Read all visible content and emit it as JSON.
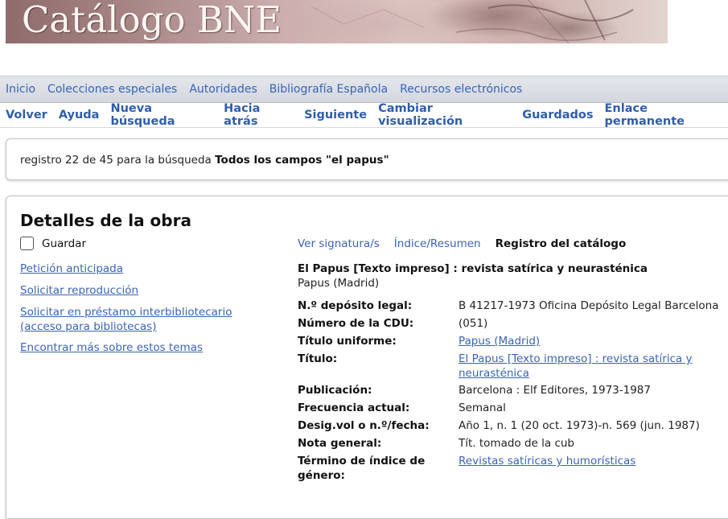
{
  "banner": {
    "title": "Catálogo BNE"
  },
  "topnav": {
    "items": [
      "Inicio",
      "Colecciones especiales",
      "Autoridades",
      "Bibliografía Española",
      "Recursos electrónicos"
    ]
  },
  "toolbar": {
    "items": [
      "Volver",
      "Ayuda",
      "Nueva búsqueda",
      "Hacia atrás",
      "Siguiente",
      "Cambiar visualización",
      "Guardados",
      "Enlace permanente"
    ]
  },
  "record": {
    "prefix": "registro 22 de 45 para la búsqueda",
    "query": "Todos los campos \"el papus\""
  },
  "details": {
    "heading": "Detalles de la obra",
    "save_label": "Guardar",
    "side_links": [
      "Petición anticipada",
      "Solicitar reproducción",
      "Solicitar en préstamo interbibliotecario (acceso para bibliotecas)",
      "Encontrar más sobre estos temas"
    ],
    "tabs": [
      "Ver signatura/s",
      "Índice/Resumen",
      "Registro del catálogo"
    ],
    "title_main": "El Papus [Texto impreso] : revista satírica y neurasténica",
    "title_sub": "Papus (Madrid)",
    "fields": [
      {
        "label": "N.º depósito legal:",
        "value": "B 41217-1973 Oficina Depósito Legal Barcelona"
      },
      {
        "label": "Número de la CDU:",
        "value": "(051)"
      },
      {
        "label": "Título uniforme:",
        "value": "Papus (Madrid)"
      },
      {
        "label": "Título:",
        "value": "El Papus [Texto impreso] : revista satírica y neurasténica"
      },
      {
        "label": "Publicación:",
        "value": "Barcelona : Elf Editores, 1973-1987"
      },
      {
        "label": "Frecuencia actual:",
        "value": "Semanal"
      },
      {
        "label": "Desig.vol o n.º/fecha:",
        "value": "Año 1, n. 1 (20 oct. 1973)-n. 569 (jun. 1987)"
      },
      {
        "label": "Nota general:",
        "value": "Tít. tomado de la cub"
      },
      {
        "label": "Término de índice de género:",
        "value": "Revistas satíricas y humorísticas"
      }
    ]
  }
}
